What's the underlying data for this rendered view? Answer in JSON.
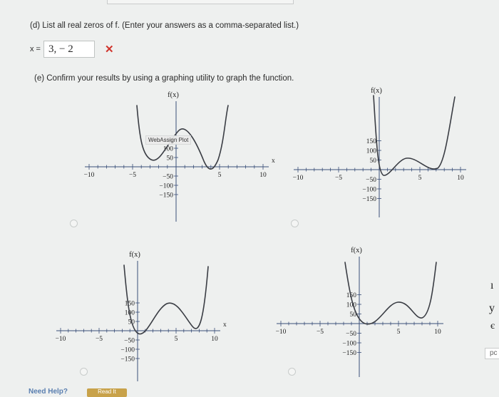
{
  "part_d": {
    "question": "(d) List all real zeros of f. (Enter your answers as a comma-separated list.)",
    "x_label": "x =",
    "answer": "3, − 2",
    "status_icon": "x-mark-icon",
    "status_color": "#d0342c"
  },
  "part_e": {
    "question": "(e) Confirm your results by using a graphing utility to graph the function.",
    "tooltip": "WebAssign Plot"
  },
  "graphs": [
    {
      "id": "top-left",
      "ylabel": "f(x)",
      "xlabel": "x",
      "x_ticks": [
        "−10",
        "−5",
        "5",
        "10"
      ],
      "y_ticks": [
        "150",
        "100",
        "50",
        "−50",
        "−100",
        "−150"
      ],
      "curve_color": "#3a3d44",
      "option_selected": false
    },
    {
      "id": "top-right",
      "ylabel": "f(x)",
      "xlabel": "",
      "x_ticks": [
        "−10",
        "−5",
        "5",
        "10"
      ],
      "y_ticks": [
        "150",
        "100",
        "50",
        "−50",
        "−100",
        "−150"
      ],
      "curve_color": "#3a3d44",
      "option_selected": false
    },
    {
      "id": "bottom-left",
      "ylabel": "f(x)",
      "xlabel": "x",
      "x_ticks": [
        "−10",
        "−5",
        "5",
        "10"
      ],
      "y_ticks": [
        "150",
        "100",
        "50",
        "−50",
        "−100",
        "−150"
      ],
      "curve_color": "#3a3d44",
      "option_selected": false
    },
    {
      "id": "bottom-right",
      "ylabel": "f(x)",
      "xlabel": "",
      "x_ticks": [
        "−10",
        "−5",
        "5",
        "10"
      ],
      "y_ticks": [
        "150",
        "100",
        "50",
        "−50",
        "−100",
        "−150"
      ],
      "curve_color": "#3a3d44",
      "option_selected": false
    }
  ],
  "footer": {
    "link": "Need Help?",
    "button": "Read It"
  },
  "edge_text": {
    "glyph_1": "ı",
    "glyph_2": "y",
    "glyph_3": "є",
    "corner": "pc"
  }
}
